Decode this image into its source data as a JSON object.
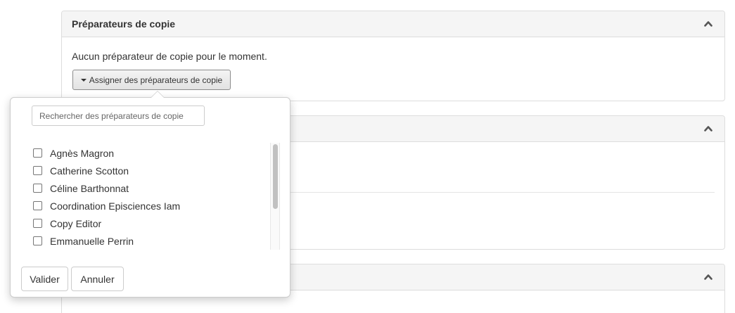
{
  "panels": [
    {
      "title": "Préparateurs de copie",
      "empty_text": "Aucun préparateur de copie pour le moment.",
      "assign_label": "Assigner des préparateurs de copie"
    },
    {
      "title": ""
    },
    {
      "title": ""
    }
  ],
  "popover": {
    "search_placeholder": "Rechercher des préparateurs de copie",
    "items": [
      {
        "label": "Agnès Magron",
        "checked": false
      },
      {
        "label": "Catherine Scotton",
        "checked": false
      },
      {
        "label": "Céline Barthonnat",
        "checked": false
      },
      {
        "label": "Coordination Episciences Iam",
        "checked": false
      },
      {
        "label": "Copy Editor",
        "checked": false
      },
      {
        "label": "Emmanuelle Perrin",
        "checked": false
      }
    ],
    "validate_label": "Valider",
    "cancel_label": "Annuler"
  },
  "icons": {
    "panel_toggle": "chevron-up-icon",
    "assign_caret": "caret-down-icon"
  },
  "colors": {
    "panel_heading_bg": "#f5f5f5",
    "border": "#dddddd"
  }
}
